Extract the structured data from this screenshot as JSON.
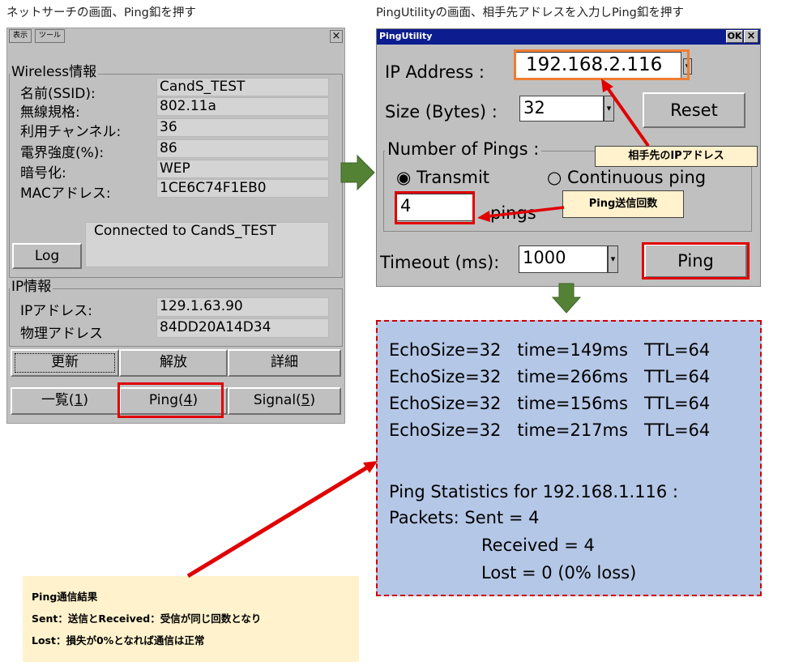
{
  "captions": {
    "left": "ネットサーチの画面、Ping釦を押す",
    "right": "PingUtilityの画面、相手先アドレスを入力しPing釦を押す"
  },
  "left_window": {
    "menu": [
      "表示",
      "ツール"
    ],
    "close": "×",
    "wireless": {
      "title": "Wireless情報",
      "rows": [
        {
          "label": "名前(SSID):",
          "value": "CandS_TEST"
        },
        {
          "label": "無線規格:",
          "value": "802.11a"
        },
        {
          "label": "利用チャンネル:",
          "value": "36"
        },
        {
          "label": "電界強度(%):",
          "value": "86"
        },
        {
          "label": "暗号化:",
          "value": "WEP"
        },
        {
          "label": "MACアドレス:",
          "value": "1CE6C74F1EB0"
        }
      ],
      "log_button": "Log",
      "status": "Connected to CandS_TEST"
    },
    "ip": {
      "title": "IP情報",
      "rows": [
        {
          "label": "IPアドレス:",
          "value": "129.1.63.90"
        },
        {
          "label": "物理アドレス",
          "value": "84DD20A14D34"
        }
      ]
    },
    "action_buttons": [
      "更新",
      "解放",
      "詳細"
    ],
    "tabs": [
      {
        "text": "一覧(",
        "key": "1",
        "end": ")"
      },
      {
        "text": "Ping(",
        "key": "4",
        "end": ")"
      },
      {
        "text": "Signal(",
        "key": "5",
        "end": ")"
      }
    ]
  },
  "ping_window": {
    "title": "PingUtility",
    "ok": "OK",
    "close": "×",
    "ip_label": "IP Address :",
    "ip_value": "192.168.2.116",
    "size_label": "Size (Bytes) :",
    "size_value": "32",
    "reset": "Reset",
    "pings_group": "Number of Pings :",
    "transmit": "Transmit",
    "continuous": "Continuous ping",
    "count_value": "4",
    "pings_unit": "pings",
    "timeout_label": "Timeout (ms):",
    "timeout_value": "1000",
    "ping_button": "Ping"
  },
  "callouts": {
    "ip": "相手先のIPアドレス",
    "count": "Ping送信回数"
  },
  "result": {
    "echo_lines": [
      "EchoSize=32   time=149ms   TTL=64",
      "EchoSize=32   time=266ms   TTL=64",
      "EchoSize=32   time=156ms   TTL=64",
      "EchoSize=32   time=217ms   TTL=64"
    ],
    "stats_title": "Ping Statistics for 192.168.1.116 :",
    "sent": "Packets: Sent = 4",
    "received": "Received = 4",
    "lost": "Lost = 0 (0% loss)"
  },
  "note": {
    "title": "Ping通信結果",
    "line1": "Sent：送信とReceived：受信が同じ回数となり",
    "line2": "Lost：損失が0%となれば通信は正常"
  },
  "colors": {
    "highlight_red": "#e00000",
    "highlight_orange": "#ef7d31",
    "arrow_green": "#548235",
    "titlebar": "#0d1d8f",
    "result_bg": "#b5c7e6",
    "note_bg": "#fff2cc"
  }
}
